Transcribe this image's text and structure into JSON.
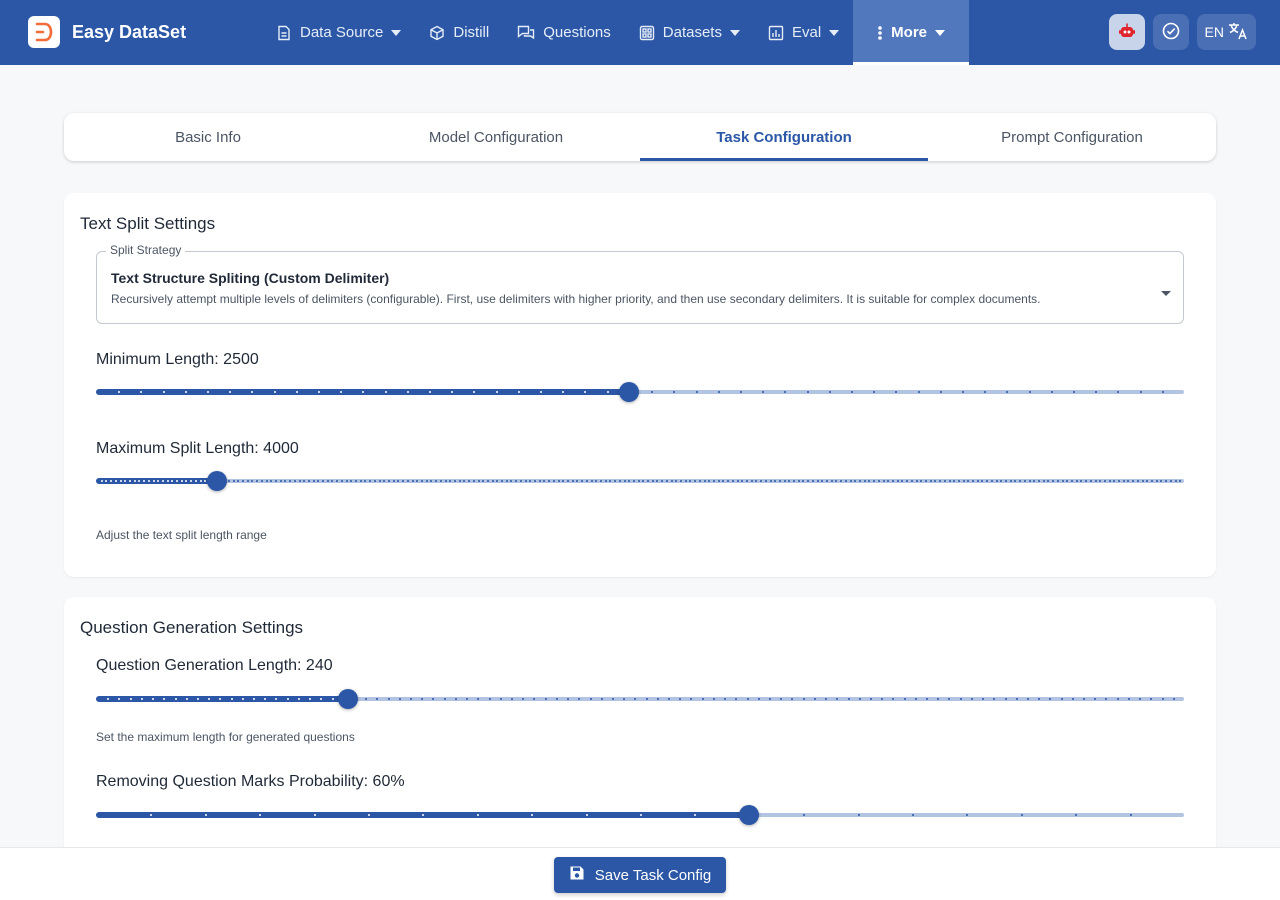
{
  "app": {
    "name": "Easy DataSet"
  },
  "nav": {
    "items": [
      {
        "label": "Data Source",
        "icon": "document-icon",
        "dropdown": true
      },
      {
        "label": "Distill",
        "icon": "cube-icon",
        "dropdown": false
      },
      {
        "label": "Questions",
        "icon": "chat-icon",
        "dropdown": false
      },
      {
        "label": "Datasets",
        "icon": "grid-icon",
        "dropdown": true
      },
      {
        "label": "Eval",
        "icon": "bar-chart-icon",
        "dropdown": true
      },
      {
        "label": "More",
        "icon": "vertical-dots-icon",
        "dropdown": true,
        "active": true
      }
    ]
  },
  "toolbar": {
    "lang_label": "EN"
  },
  "tabs": [
    {
      "label": "Basic Info"
    },
    {
      "label": "Model Configuration"
    },
    {
      "label": "Task Configuration",
      "active": true
    },
    {
      "label": "Prompt Configuration"
    }
  ],
  "text_split": {
    "title": "Text Split Settings",
    "strategy": {
      "legend": "Split Strategy",
      "value": "Text Structure Spliting (Custom Delimiter)",
      "description": "Recursively attempt multiple levels of delimiters (configurable). First, use delimiters with higher priority, and then use secondary delimiters. It is suitable for complex documents."
    },
    "min_length": {
      "label": "Minimum Length: 2500",
      "fraction": 0.49
    },
    "max_length": {
      "label": "Maximum Split Length: 4000",
      "fraction": 0.111
    },
    "helper": "Adjust the text split length range"
  },
  "question_gen": {
    "title": "Question Generation Settings",
    "gen_length": {
      "label": "Question Generation Length: 240",
      "fraction": 0.232
    },
    "gen_length_helper": "Set the maximum length for generated questions",
    "remove_marks": {
      "label": "Removing Question Marks Probability: 60%",
      "fraction": 0.6
    }
  },
  "footer": {
    "save_label": "Save Task Config"
  },
  "colors": {
    "primary": "#2b57a6",
    "rail": "#b3c4e2",
    "header": "#2b57a6"
  }
}
